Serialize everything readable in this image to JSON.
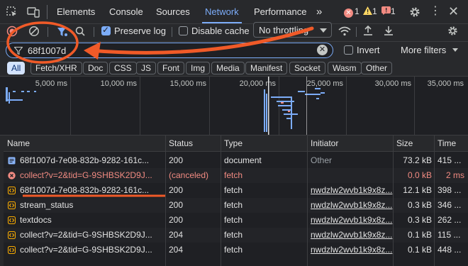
{
  "tabs": {
    "items": [
      "Elements",
      "Console",
      "Sources",
      "Network",
      "Performance"
    ],
    "more": "»"
  },
  "badges": {
    "errors": "1",
    "warnings": "1",
    "issues": "1"
  },
  "toolbar": {
    "preserve_log_label": "Preserve log",
    "preserve_log_checked": true,
    "disable_cache_label": "Disable cache",
    "disable_cache_checked": false,
    "throttling": "No throttling"
  },
  "filter": {
    "value": "68f1007d",
    "invert_label": "Invert",
    "more_filters_label": "More filters"
  },
  "chips": [
    "All",
    "Fetch/XHR",
    "Doc",
    "CSS",
    "JS",
    "Font",
    "Img",
    "Media",
    "Manifest",
    "Socket",
    "Wasm",
    "Other"
  ],
  "overview": {
    "ticks": [
      "5,000 ms",
      "10,000 ms",
      "15,000 ms",
      "20,000 ms",
      "25,000 ms",
      "30,000 ms",
      "35,000 ms"
    ]
  },
  "table": {
    "headers": [
      "Name",
      "Status",
      "Type",
      "Initiator",
      "Size",
      "Time"
    ],
    "rows": [
      {
        "name": "68f1007d-7e08-832b-9282-161c...",
        "status": "200",
        "type": "document",
        "initiator": "Other",
        "size": "73.2 kB",
        "time": "415 ...",
        "icon": "document-icon",
        "error": false
      },
      {
        "name": "collect?v=2&tid=G-9SHBSK2D9J...",
        "status": "(canceled)",
        "type": "fetch",
        "initiator": "",
        "size": "0.0 kB",
        "time": "2 ms",
        "icon": "error-icon",
        "error": true
      },
      {
        "name": "68f1007d-7e08-832b-9282-161c...",
        "status": "200",
        "type": "fetch",
        "initiator": "nwdzlw2wvb1k9x8z...",
        "size": "12.1 kB",
        "time": "398 ...",
        "icon": "fetch-icon",
        "error": false
      },
      {
        "name": "stream_status",
        "status": "200",
        "type": "fetch",
        "initiator": "nwdzlw2wvb1k9x8z...",
        "size": "0.3 kB",
        "time": "346 ...",
        "icon": "fetch-icon",
        "error": false
      },
      {
        "name": "textdocs",
        "status": "200",
        "type": "fetch",
        "initiator": "nwdzlw2wvb1k9x8z...",
        "size": "0.3 kB",
        "time": "262 ...",
        "icon": "fetch-icon",
        "error": false
      },
      {
        "name": "collect?v=2&tid=G-9SHBSK2D9J...",
        "status": "204",
        "type": "fetch",
        "initiator": "nwdzlw2wvb1k9x8z...",
        "size": "0.1 kB",
        "time": "115 ...",
        "icon": "fetch-icon",
        "error": false
      },
      {
        "name": "collect?v=2&tid=G-9SHBSK2D9J...",
        "status": "204",
        "type": "fetch",
        "initiator": "nwdzlw2wvb1k9x8z...",
        "size": "0.1 kB",
        "time": "448 ...",
        "icon": "fetch-icon",
        "error": false
      }
    ]
  },
  "colors": {
    "accent": "#7cacf8",
    "error": "#f28b82",
    "annotation": "#f05a28"
  }
}
